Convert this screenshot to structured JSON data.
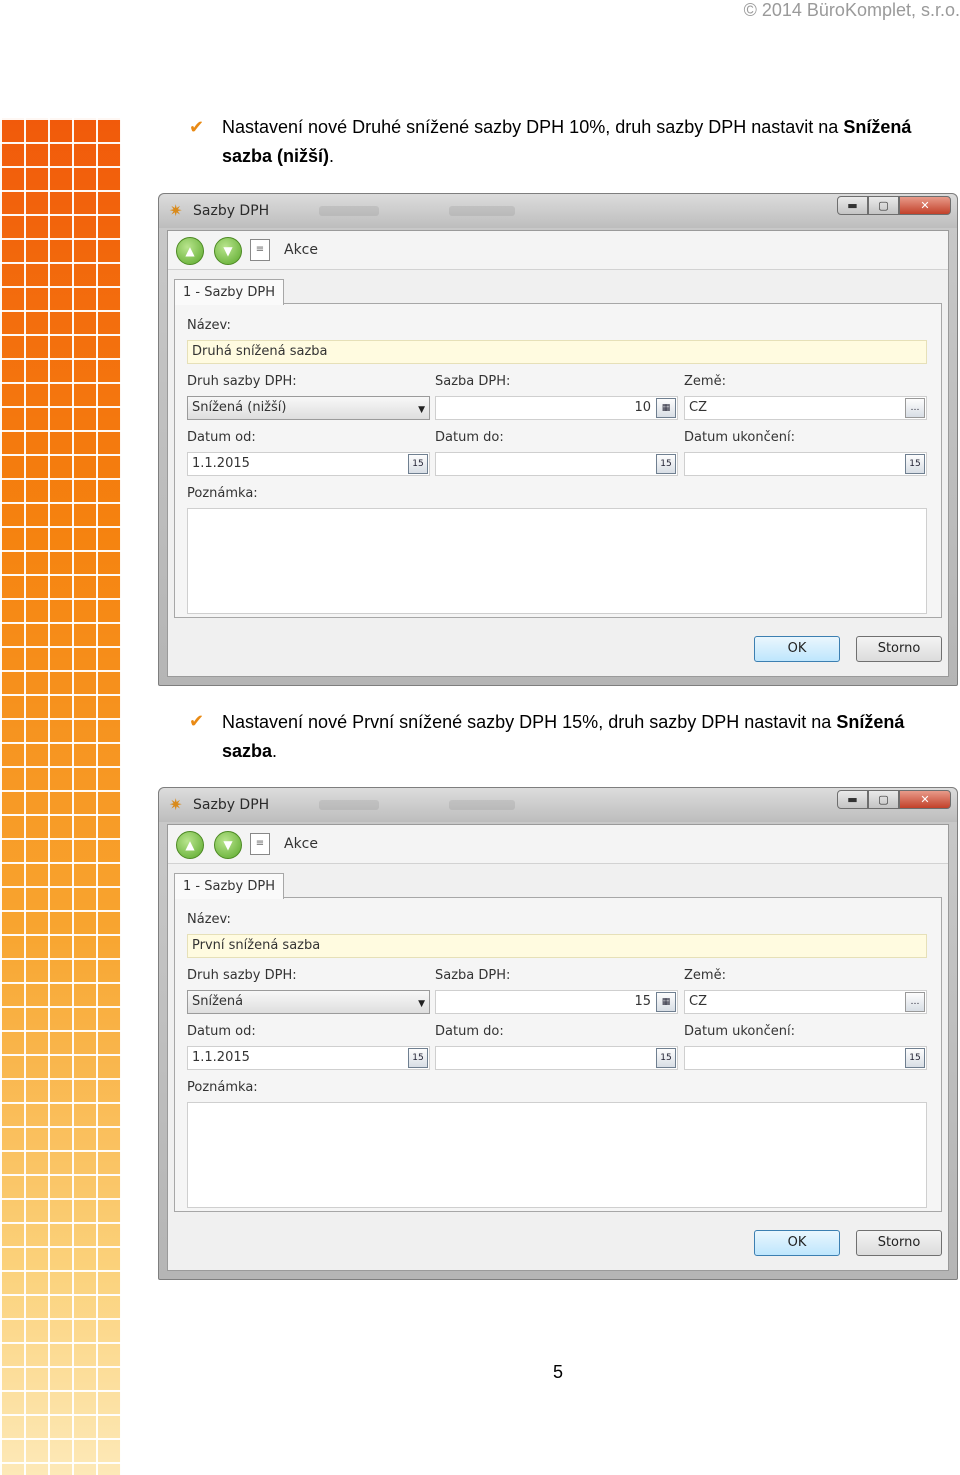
{
  "header": {
    "copyright": "© 2014 BüroKomplet, s.r.o."
  },
  "page_number": "5",
  "bullets": [
    {
      "text_before": "Nastavení nové Druhé snížené sazby DPH 10%, druh sazby DPH nastavit na ",
      "bold": "Snížená sazba (nižší)",
      "text_after": "."
    },
    {
      "text_before": "Nastavení nové První snížené sazby DPH 15%, druh sazby DPH nastavit na ",
      "bold": "Snížená sazba",
      "text_after": "."
    }
  ],
  "dialogs": [
    {
      "title": "Sazby DPH",
      "toolbar_label": "Akce",
      "tab": "1 - Sazby DPH",
      "labels": {
        "nazev": "Název:",
        "druh": "Druh sazby DPH:",
        "sazba": "Sazba DPH:",
        "zeme": "Země:",
        "datum_od": "Datum od:",
        "datum_do": "Datum do:",
        "datum_ukonceni": "Datum ukončení:",
        "poznamka": "Poznámka:"
      },
      "values": {
        "nazev": "Druhá snížená sazba",
        "druh": "Snížená (nižší)",
        "sazba": "10",
        "zeme": "CZ",
        "datum_od": "1.1.2015",
        "datum_do": "",
        "datum_ukonceni": ""
      },
      "buttons": {
        "ok": "OK",
        "storno": "Storno"
      }
    },
    {
      "title": "Sazby DPH",
      "toolbar_label": "Akce",
      "tab": "1 - Sazby DPH",
      "labels": {
        "nazev": "Název:",
        "druh": "Druh sazby DPH:",
        "sazba": "Sazba DPH:",
        "zeme": "Země:",
        "datum_od": "Datum od:",
        "datum_do": "Datum do:",
        "datum_ukonceni": "Datum ukončení:",
        "poznamka": "Poznámka:"
      },
      "values": {
        "nazev": "První snížená sazba",
        "druh": "Snížená",
        "sazba": "15",
        "zeme": "CZ",
        "datum_od": "1.1.2015",
        "datum_do": "",
        "datum_ukonceni": ""
      },
      "buttons": {
        "ok": "OK",
        "storno": "Storno"
      }
    }
  ],
  "icons": {
    "bullet": "checkmark-icon",
    "app": "app-logo-icon",
    "up": "arrow-up-icon",
    "down": "arrow-down-icon",
    "actions": "document-cursor-icon",
    "calendar": "calendar-icon",
    "calculator": "calculator-icon",
    "ellipsis": "ellipsis-icon"
  },
  "colors": {
    "stripe_top": "#f15a0b",
    "stripe_bottom": "#fde9b8",
    "ok_button": "#bee6fd",
    "name_field": "#fffbe0"
  }
}
